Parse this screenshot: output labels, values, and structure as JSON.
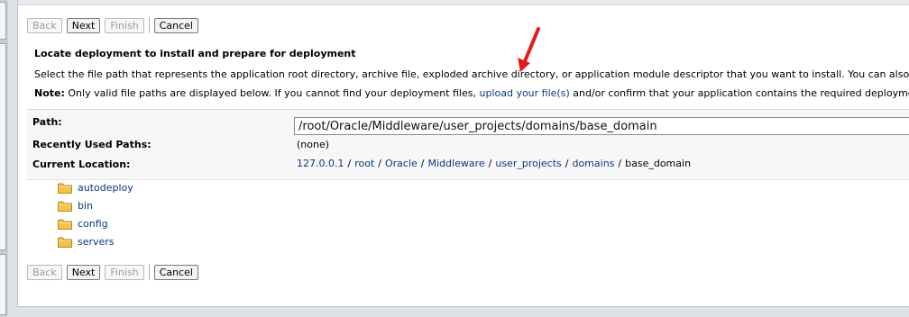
{
  "buttons": {
    "back": "Back",
    "next": "Next",
    "finish": "Finish",
    "cancel": "Cancel"
  },
  "title": "Locate deployment to install and prepare for deployment",
  "description": "Select the file path that represents the application root directory, archive file, exploded archive directory, or application module descriptor that you want to install. You can also enter the path of the app",
  "note": {
    "label": "Note:",
    "text_before": " Only valid file paths are displayed below. If you cannot find your deployment files, ",
    "link": "upload your file(s)",
    "text_after": " and/or confirm that your application contains the required deployment descriptors."
  },
  "form": {
    "path_label": "Path:",
    "path_value": "/root/Oracle/Middleware/user_projects/domains/base_domain",
    "recent_label": "Recently Used Paths:",
    "recent_value": "(none)",
    "location_label": "Current Location:",
    "breadcrumb": [
      "127.0.0.1",
      "root",
      "Oracle",
      "Middleware",
      "user_projects",
      "domains"
    ],
    "current": "base_domain",
    "separator": "/"
  },
  "folders": [
    "autodeploy",
    "bin",
    "config",
    "servers"
  ],
  "colors": {
    "link": "#0a3a7a",
    "folder": "#f2c14e",
    "arrow": "#e31b1b"
  }
}
